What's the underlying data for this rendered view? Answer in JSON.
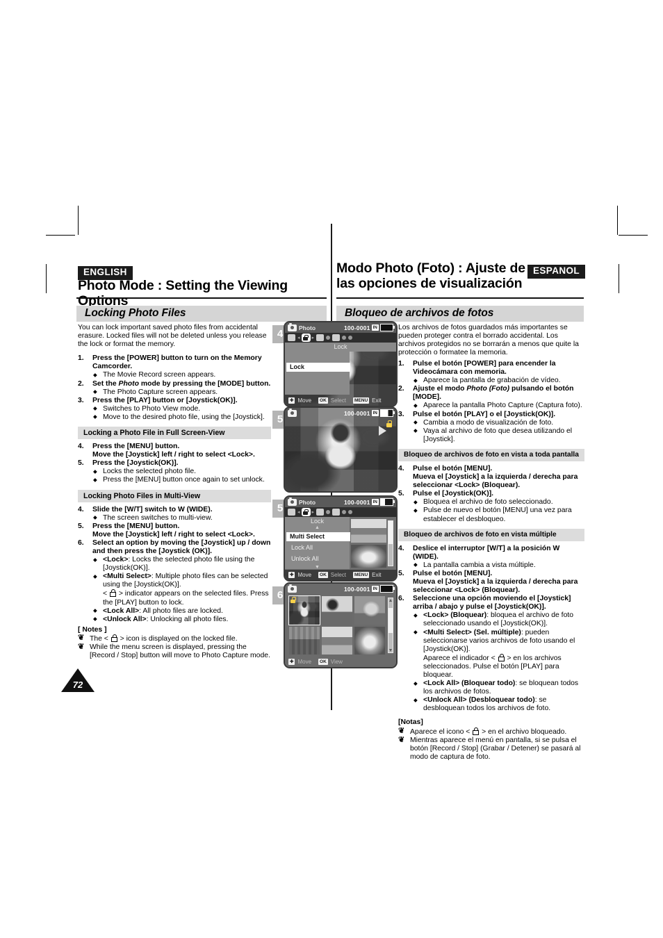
{
  "page": {
    "number": "72",
    "language_left": "ENGLISH",
    "language_right": "ESPANOL"
  },
  "header": {
    "title_en": "Photo Mode : Setting the Viewing Options",
    "title_es": "Modo Photo (Foto) : Ajuste de las opciones de visualización"
  },
  "section": {
    "title_en": "Locking Photo Files",
    "title_es": "Bloqueo de archivos de fotos"
  },
  "english": {
    "intro": "You can lock important saved photo files from accidental erasure. Locked files will not be deleted unless you release the lock or format the memory.",
    "steps": [
      {
        "num": "1.",
        "text": "Press the [POWER] button to turn on the Memory Camcorder.",
        "bullets": [
          "The Movie Record screen appears."
        ]
      },
      {
        "num": "2.",
        "text_pre": "Set the ",
        "text_em": "Photo",
        "text_post": " mode by pressing the [MODE] button.",
        "bullets": [
          "The Photo Capture screen appears."
        ]
      },
      {
        "num": "3.",
        "text": "Press the [PLAY] button or [Joystick(OK)].",
        "bullets": [
          "Switches to Photo View mode.",
          "Move to the desired photo file, using the [Joystick]."
        ]
      }
    ],
    "subhead_full": "Locking  a Photo File in Full Screen-View",
    "steps_full": [
      {
        "num": "4.",
        "line1": "Press the [MENU] button.",
        "line2": "Move the [Joystick] left / right to select <Lock>."
      },
      {
        "num": "5.",
        "line1": "Press the [Joystick(OK)].",
        "bullets": [
          "Locks the selected photo file.",
          "Press the [MENU] button once again to set unlock."
        ]
      }
    ],
    "subhead_multi": "Locking Photo Files in Multi-View",
    "steps_multi": [
      {
        "num": "4.",
        "line1": "Slide the [W/T] switch to W (WIDE).",
        "bullets": [
          "The screen switches to multi-view."
        ]
      },
      {
        "num": "5.",
        "line1": "Press the [MENU] button.",
        "line2": "Move the [Joystick] left / right to select <Lock>."
      },
      {
        "num": "6.",
        "line1": "Select an option by moving the [Joystick] up / down and then press the [Joystick (OK)]."
      }
    ],
    "options": [
      {
        "label": "<Lock>",
        "desc": ": Locks the selected photo file using the [Joystick(OK)]."
      },
      {
        "label": "<Multi Select>",
        "desc": ": Multiple photo files can be selected using the [Joystick(OK)].",
        "extra_pre": "< ",
        "extra_post": " > indicator appears on the selected files. Press the [PLAY] button to lock."
      },
      {
        "label": "<Lock All>",
        "desc": ": All photo files are locked."
      },
      {
        "label": "<Unlock All>",
        "desc": ": Unlocking all photo files."
      }
    ],
    "notes_title": "[ Notes ]",
    "notes": [
      {
        "pre": "The < ",
        "post": " > icon is displayed on the locked file."
      },
      {
        "pre": "While the menu screen is displayed, pressing the [Record / Stop] button will move to Photo Capture mode.",
        "post": ""
      }
    ]
  },
  "spanish": {
    "intro": "Los archivos de fotos guardados más importantes se pueden proteger contra el borrado accidental. Los archivos protegidos no se borrarán a menos que quite la protección o formatee la memoria.",
    "steps": [
      {
        "num": "1.",
        "text": "Pulse el botón [POWER] para encender la Videocámara con memoria.",
        "bullets": [
          "Aparece la pantalla de grabación de vídeo."
        ]
      },
      {
        "num": "2.",
        "text_pre": "Ajuste el modo ",
        "text_em": "Photo (Foto)",
        "text_post": " pulsando el botón [MODE].",
        "bullets": [
          "Aparece la pantalla Photo Capture (Captura foto)."
        ]
      },
      {
        "num": "3.",
        "text": "Pulse el botón [PLAY] o el [Joystick(OK)].",
        "bullets": [
          "Cambia a modo de visualización de foto.",
          "Vaya al archivo de foto que desea utilizando el [Joystick]."
        ]
      }
    ],
    "subhead_full": "Bloqueo de archivos de foto en vista a toda pantalla",
    "steps_full": [
      {
        "num": "4.",
        "line1": "Pulse el botón [MENU].",
        "line2": "Mueva el [Joystick] a la izquierda / derecha para seleccionar <Lock> (Bloquear)."
      },
      {
        "num": "5.",
        "line1": "Pulse el [Joystick(OK)].",
        "bullets": [
          "Bloquea el archivo de foto seleccionado.",
          "Pulse de nuevo el botón [MENU] una vez para establecer el desbloqueo."
        ]
      }
    ],
    "subhead_multi": "Bloqueo de archivos de foto en vista múltiple",
    "steps_multi": [
      {
        "num": "4.",
        "line1": "Deslice el interruptor [W/T] a la posición W (WIDE).",
        "bullets": [
          "La pantalla cambia a vista múltiple."
        ]
      },
      {
        "num": "5.",
        "line1": "Pulse el botón [MENU].",
        "line2": "Mueva el [Joystick] a la izquierda / derecha para seleccionar <Lock> (Bloquear)."
      },
      {
        "num": "6.",
        "line1": "Seleccione una opción moviendo el [Joystick] arriba / abajo y pulse el [Joystick(OK)]."
      }
    ],
    "options": [
      {
        "label": "<Lock> (Bloquear)",
        "desc": ": bloquea el archivo de foto seleccionado usando el [Joystick(OK)]."
      },
      {
        "label": "<Multi Select> (Sel. múltiple)",
        "desc": ": pueden seleccionarse varios archivos de foto usando el [Joystick(OK)].",
        "extra_pre": "Aparece el indicador < ",
        "extra_post": " > en los archivos seleccionados. Pulse el botón [PLAY] para bloquear."
      },
      {
        "label": "<Lock All> (Bloquear todo)",
        "desc": ": se bloquean todos los archivos de fotos."
      },
      {
        "label": "<Unlock All> (Desbloquear todo)",
        "desc": ": se desbloquean todos los archivos de foto."
      }
    ],
    "notes_title": "[Notas]",
    "notes": [
      {
        "pre": "Aparece el icono < ",
        "post": " > en el archivo bloqueado."
      },
      {
        "pre": "Mientras aparece el menú en pantalla, si se pulsa el botón [Record / Stop] (Grabar / Detener) se pasará al modo de captura de foto.",
        "post": ""
      }
    ]
  },
  "screens": [
    {
      "step": "4",
      "mode_label": "Photo",
      "file_number": "100-0001",
      "card_badge": "IN",
      "menu_title": "Lock",
      "menu_items": [
        "Lock"
      ],
      "guide": {
        "move": "Move",
        "ok_key": "OK",
        "select": "Select",
        "menu_key": "MENU",
        "exit": "Exit"
      }
    },
    {
      "step": "5",
      "file_number": "100-0001",
      "card_badge": "IN"
    },
    {
      "step": "5",
      "mode_label": "Photo",
      "file_number": "100-0001",
      "card_badge": "IN",
      "menu_title": "Lock",
      "menu_items": [
        "Multi Select",
        "Lock All",
        "Unlock All"
      ],
      "guide": {
        "move": "Move",
        "ok_key": "OK",
        "select": "Select",
        "menu_key": "MENU",
        "exit": "Exit"
      }
    },
    {
      "step": "6",
      "file_number": "100-0001",
      "card_badge": "IN",
      "guide": {
        "move": "Move",
        "ok_key": "OK",
        "view": "View"
      }
    }
  ]
}
